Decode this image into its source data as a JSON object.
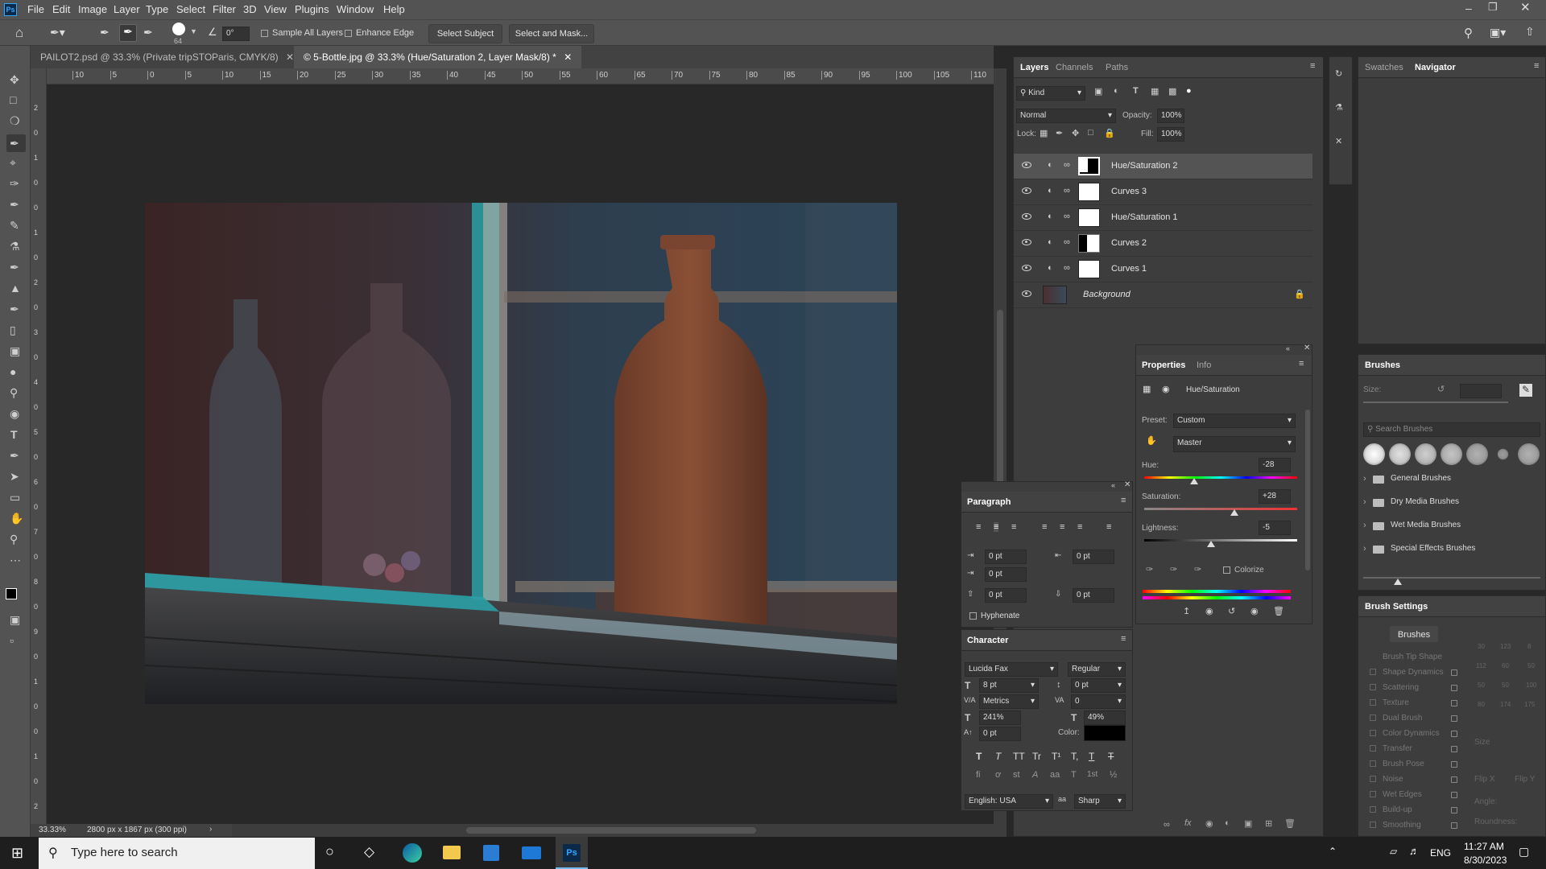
{
  "menu": {
    "items": [
      "File",
      "Edit",
      "Image",
      "Layer",
      "Type",
      "Select",
      "Filter",
      "3D",
      "View",
      "Plugins",
      "Window",
      "Help"
    ],
    "app_badge": "Ps"
  },
  "options": {
    "brush_size": "64",
    "angle": "0°",
    "sample_all_layers": "Sample All Layers",
    "enhance_edge": "Enhance Edge",
    "select_subject": "Select Subject",
    "select_and_mask": "Select and Mask..."
  },
  "tabs": [
    {
      "label": "PAILOT2.psd @ 33.3% (Private tripSTO"
    },
    {
      "label": "Paris, CMYK/8)"
    },
    {
      "label": "© 5-Bottle.jpg @ 33.3% (Hue/Saturation 2, Layer Mask/8) *"
    }
  ],
  "ruler": {
    "h": [
      "10",
      "5",
      "0",
      "5",
      "10",
      "15",
      "20",
      "25",
      "30",
      "35",
      "40",
      "45",
      "50",
      "55",
      "60",
      "65",
      "70",
      "75",
      "80",
      "85",
      "90",
      "95",
      "100",
      "105",
      "110"
    ],
    "v": [
      "2",
      "0",
      "1",
      "0",
      "0",
      "1",
      "0",
      "2",
      "0",
      "3",
      "0",
      "4",
      "0",
      "5",
      "0",
      "6",
      "0",
      "7",
      "0",
      "8",
      "0",
      "9",
      "0",
      "1",
      "0",
      "0",
      "1",
      "0",
      "2"
    ]
  },
  "status": {
    "zoom": "33.33%",
    "doc": "2800 px x 1867 px (300 ppi)"
  },
  "layers_panel": {
    "tabs": [
      "Layers",
      "Channels",
      "Paths"
    ],
    "kind": "Kind",
    "blend": "Normal",
    "opacity_label": "Opacity:",
    "opacity": "100%",
    "lock_label": "Lock:",
    "fill_label": "Fill:",
    "fill": "100%",
    "layers": [
      {
        "name": "Hue/Saturation 2"
      },
      {
        "name": "Curves 3"
      },
      {
        "name": "Hue/Saturation 1"
      },
      {
        "name": "Curves 2"
      },
      {
        "name": "Curves 1"
      },
      {
        "name": "Background"
      }
    ]
  },
  "swatches_panel": {
    "tabs": [
      "Swatches",
      "Navigator"
    ]
  },
  "properties_panel": {
    "tabs": [
      "Properties",
      "Info"
    ],
    "type": "Hue/Saturation",
    "preset_label": "Preset:",
    "preset": "Custom",
    "channel": "Master",
    "hue_label": "Hue:",
    "hue": "-28",
    "saturation_label": "Saturation:",
    "saturation": "+28",
    "lightness_label": "Lightness:",
    "lightness": "-5",
    "colorize": "Colorize"
  },
  "brushes_panel": {
    "title": "Brushes",
    "size_label": "Size:",
    "search_placeholder": "Search Brushes",
    "folders": [
      "General Brushes",
      "Dry Media Brushes",
      "Wet Media Brushes",
      "Special Effects Brushes"
    ]
  },
  "brush_settings": {
    "title": "Brush Settings",
    "brushes_button": "Brushes",
    "items": [
      "Brush Tip Shape",
      "Shape Dynamics",
      "Scattering",
      "Texture",
      "Dual Brush",
      "Color Dynamics",
      "Transfer",
      "Brush Pose",
      "Noise",
      "Wet Edges",
      "Build-up",
      "Smoothing"
    ],
    "preset_nums": [
      "30",
      "123",
      "8",
      "112",
      "60",
      "50",
      "50",
      "50",
      "100",
      "80",
      "174",
      "175"
    ],
    "size_label": "Size",
    "flip_x": "Flip X",
    "flip_y": "Flip Y",
    "angle": "Angle:",
    "roundness": "Roundness:"
  },
  "paragraph_panel": {
    "title": "Paragraph",
    "indent_left": "0 pt",
    "indent_right": "0 pt",
    "first_line": "0 pt",
    "space_before": "0 pt",
    "space_after": "0 pt",
    "hyphenate": "Hyphenate"
  },
  "character_panel": {
    "title": "Character",
    "font": "Lucida Fax",
    "style": "Regular",
    "size": "8 pt",
    "leading": "0 pt",
    "kerning": "Metrics",
    "tracking": "0",
    "vscale": "241%",
    "hscale": "49%",
    "baseline": "0 pt",
    "color_label": "Color:",
    "language": "English: USA",
    "antialias": "Sharp",
    "style_buttons": [
      "T",
      "T",
      "TT",
      "Tr",
      "T¹",
      "T,",
      "T",
      "T"
    ],
    "opentype_buttons": [
      "fi",
      "ơ",
      "st",
      "A",
      "aa",
      "T",
      "1st",
      "½"
    ]
  },
  "taskbar": {
    "search_placeholder": "Type here to search",
    "time": "11:27 AM",
    "date": "8/30/2023",
    "lang": "ENG",
    "ps_label": "Ps"
  },
  "colors": {
    "menu_bg": "#535353",
    "panel_bg": "#3d3d3d",
    "canvas_bg": "#282828",
    "teal_paint": "#2b9fa6",
    "bottle": "#7a4530"
  }
}
